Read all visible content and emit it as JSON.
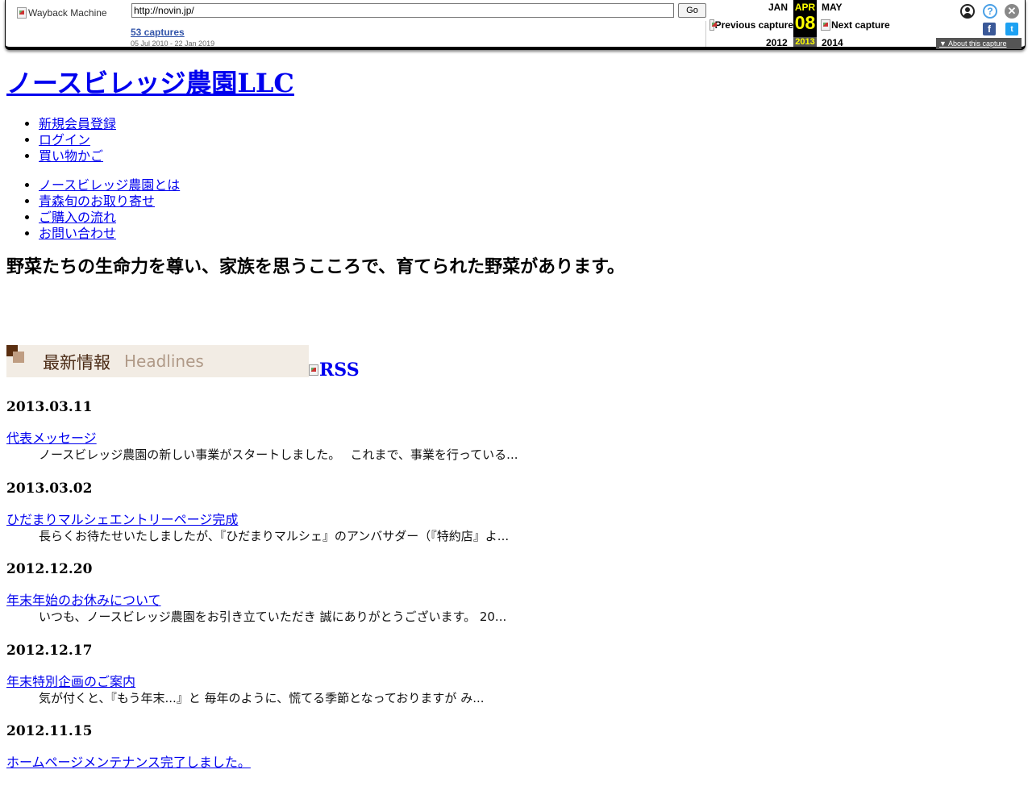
{
  "wayback": {
    "logo_alt": "Wayback Machine",
    "url": "http://novin.jp/",
    "go_label": "Go",
    "captures_label": "53 captures",
    "date_range": "05 Jul 2010 - 22 Jan 2019",
    "prev_month": "JAN",
    "current_month": "APR",
    "next_month": "MAY",
    "current_day": "08",
    "prev_year": "2012",
    "current_year": "2013",
    "next_year": "2014",
    "prev_capture_label": "Previous capture",
    "next_capture_label": "Next capture",
    "about_label": "About this capture",
    "help_glyph": "?",
    "close_glyph": "✕",
    "facebook_glyph": "f",
    "twitter_glyph": "t",
    "about_caret": "▼"
  },
  "site": {
    "title": "ノースビレッジ農園LLC",
    "user_menu": [
      "新規会員登録",
      "ログイン",
      "買い物かご"
    ],
    "main_menu": [
      "ノースビレッジ農園とは",
      "青森旬のお取り寄せ",
      "ご購入の流れ",
      "お問い合わせ"
    ],
    "tagline": "野菜たちの生命力を尊い、家族を思うこころで、育てられた野菜があります。",
    "headlines_jp": "最新情報",
    "headlines_en": "Headlines",
    "rss_alt": "RSS"
  },
  "news": [
    {
      "date": "2013.03.11",
      "title": "代表メッセージ",
      "excerpt": "ノースビレッジ農園の新しい事業がスタートしました。　 これまで、事業を行っている..."
    },
    {
      "date": "2013.03.02",
      "title": "ひだまりマルシェエントリーページ完成",
      "excerpt": "長らくお待たせいたしましたが、『ひだまりマルシェ』のアンバサダー（『特約店』よ..."
    },
    {
      "date": "2012.12.20",
      "title": "年末年始のお休みについて",
      "excerpt": "いつも、ノースビレッジ農園をお引き立ていただき 誠にありがとうございます。 20..."
    },
    {
      "date": "2012.12.17",
      "title": "年末特別企画のご案内",
      "excerpt": "気が付くと、『もう年末...』と 毎年のように、慌てる季節となっておりますが み..."
    },
    {
      "date": "2012.11.15",
      "title": "ホームページメンテナンス完了しました。",
      "excerpt": ""
    }
  ]
}
